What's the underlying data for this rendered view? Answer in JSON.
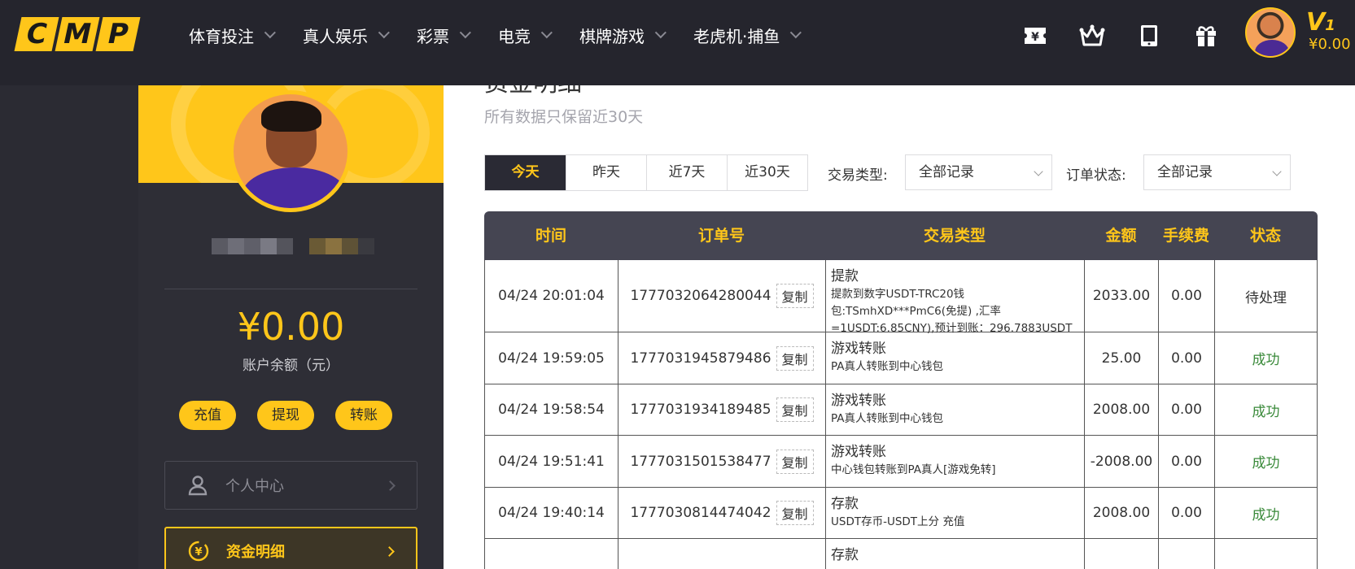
{
  "header": {
    "logo_letters": [
      "C",
      "M",
      "P"
    ],
    "nav": [
      {
        "label": "体育投注"
      },
      {
        "label": "真人娱乐"
      },
      {
        "label": "彩票"
      },
      {
        "label": "电竞"
      },
      {
        "label": "棋牌游戏"
      },
      {
        "label": "老虎机·捕鱼"
      }
    ],
    "icons": [
      "ticket-icon",
      "crown-icon",
      "tablet-icon",
      "gift-icon"
    ],
    "vip_prefix": "V",
    "vip_level": "1",
    "balance": "¥0.00"
  },
  "sidebar": {
    "balance": "¥0.00",
    "balance_label": "账户余额（元）",
    "actions": [
      {
        "label": "充值"
      },
      {
        "label": "提现"
      },
      {
        "label": "转账"
      }
    ],
    "menu": [
      {
        "label": "个人中心",
        "icon": "user-icon",
        "active": false
      },
      {
        "label": "资金明细",
        "icon": "yuan-coin-icon",
        "active": true
      }
    ]
  },
  "main": {
    "title": "资金明细",
    "subtitle": "所有数据只保留近30天",
    "date_tabs": [
      {
        "label": "今天",
        "active": true
      },
      {
        "label": "昨天",
        "active": false
      },
      {
        "label": "近7天",
        "active": false
      },
      {
        "label": "近30天",
        "active": false
      }
    ],
    "filters": {
      "type_label": "交易类型:",
      "type_value": "全部记录",
      "status_label": "订单状态:",
      "status_value": "全部记录"
    },
    "table": {
      "columns": [
        "时间",
        "订单号",
        "交易类型",
        "金额",
        "手续费",
        "状态"
      ],
      "copy_label": "复制",
      "rows": [
        {
          "time": "04/24 20:01:04",
          "order": "1777032064280044",
          "type": "提款",
          "desc": "提款到数字USDT-TRC20钱包:TSmhXD***PmC6(免提) ,汇率=1USDT:6.85CNY),预计到账：296.7883USDT",
          "amount": "2033.00",
          "fee": "0.00",
          "status": "待处理",
          "status_kind": "pending"
        },
        {
          "time": "04/24 19:59:05",
          "order": "1777031945879486",
          "type": "游戏转账",
          "desc": "PA真人转账到中心钱包",
          "amount": "25.00",
          "fee": "0.00",
          "status": "成功",
          "status_kind": "success"
        },
        {
          "time": "04/24 19:58:54",
          "order": "1777031934189485",
          "type": "游戏转账",
          "desc": "PA真人转账到中心钱包",
          "amount": "2008.00",
          "fee": "0.00",
          "status": "成功",
          "status_kind": "success"
        },
        {
          "time": "04/24 19:51:41",
          "order": "1777031501538477",
          "type": "游戏转账",
          "desc": "中心钱包转账到PA真人[游戏免转]",
          "amount": "-2008.00",
          "fee": "0.00",
          "status": "成功",
          "status_kind": "success"
        },
        {
          "time": "04/24 19:40:14",
          "order": "1777030814474042",
          "type": "存款",
          "desc": "USDT存币-USDT上分 充值",
          "amount": "2008.00",
          "fee": "0.00",
          "status": "成功",
          "status_kind": "success"
        },
        {
          "time": "",
          "order": "",
          "type": "存款",
          "desc": "",
          "amount": "",
          "fee": "",
          "status": "",
          "status_kind": "success"
        }
      ]
    }
  },
  "colors": {
    "accent": "#ffc61a",
    "topbar_bg": "#25252d",
    "sidebar_bg": "#2e2e36",
    "table_header_bg": "#454552",
    "success": "#3a8a3a"
  }
}
